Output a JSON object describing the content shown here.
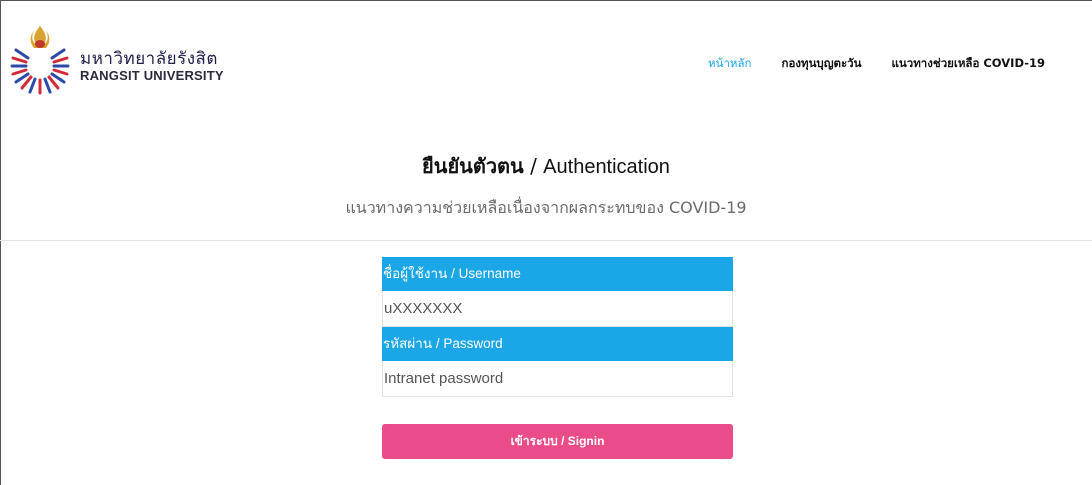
{
  "header": {
    "brand_th": "มหาวิทยาลัยรังสิต",
    "brand_en": "RANGSIT UNIVERSITY",
    "nav": [
      {
        "label": "หน้าหลัก",
        "active": true
      },
      {
        "label": "กองทุนบุญตะวัน",
        "active": false
      },
      {
        "label": "แนวทางช่วยเหลือ COVID-19",
        "active": false
      }
    ]
  },
  "main": {
    "title_th": "ยืนยันตัวตน",
    "title_sep": " / ",
    "title_en": "Authentication",
    "subtitle": "แนวทางความช่วยเหลือเนื่องจากผลกระทบของ COVID-19"
  },
  "form": {
    "username_label": "ชื่อผู้ใช้งาน / Username",
    "username_placeholder": "uXXXXXXX",
    "password_label": "รหัสผ่าน / Password",
    "password_placeholder": "Intranet password",
    "signin_label": "เข้าระบบ / Signin"
  },
  "colors": {
    "accent_blue": "#1ba6e8",
    "signin_pink": "#ea4c89",
    "nav_active": "#1aa3e8"
  }
}
